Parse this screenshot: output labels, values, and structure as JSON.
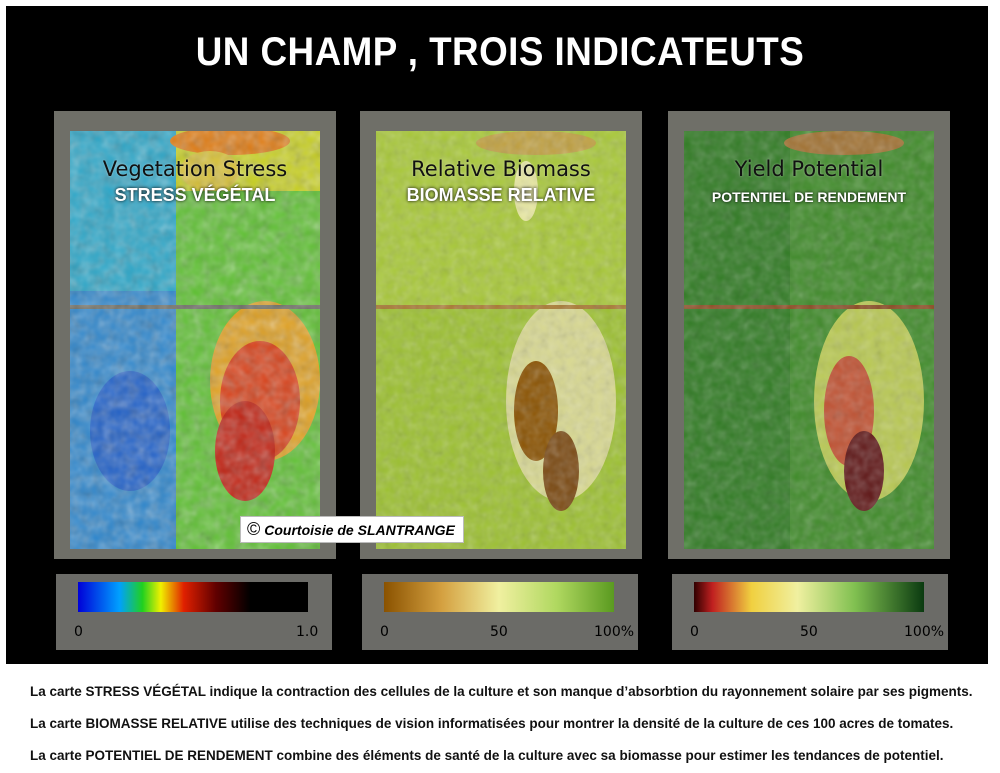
{
  "title": "UN CHAMP , TROIS INDICATEUTS",
  "panels": [
    {
      "label_en": "Vegetation Stress",
      "label_fr": "STRESS VÉGÉTAL"
    },
    {
      "label_en": "Relative Biomass",
      "label_fr": "BIOMASSE RELATIVE"
    },
    {
      "label_en": "Yield Potential",
      "label_fr": "POTENTIEL DE RENDEMENT"
    }
  ],
  "legends": [
    {
      "ticks": [
        "0",
        "1.0"
      ],
      "colors": [
        "#0000d8",
        "#00a0ff",
        "#20d020",
        "#f0f000",
        "#e02000",
        "#600000",
        "#000000"
      ]
    },
    {
      "ticks": [
        "0",
        "50",
        "100%"
      ],
      "colors": [
        "#8a5200",
        "#d4a040",
        "#f0f0a0",
        "#b0d860",
        "#5a9a20"
      ]
    },
    {
      "ticks": [
        "0",
        "50",
        "100%"
      ],
      "colors": [
        "#300000",
        "#c02020",
        "#f0d040",
        "#f0f0a0",
        "#80c050",
        "#0a3a10"
      ]
    }
  ],
  "credit": {
    "symbol": "©",
    "text": "Courtoisie de SLANTRANGE"
  },
  "descriptions": [
    "La carte STRESS VÉGÉTAL indique la contraction des cellules de la culture et son manque d’absorbtion du rayonnement solaire par ses pigments.",
    "La carte BIOMASSE RELATIVE utilise des techniques de vision informatisées pour montrer la densité de la culture de ces 100 acres de tomates.",
    "La carte POTENTIEL DE RENDEMENT combine des éléments de santé de la culture avec sa biomasse pour estimer les tendances de potentiel."
  ]
}
